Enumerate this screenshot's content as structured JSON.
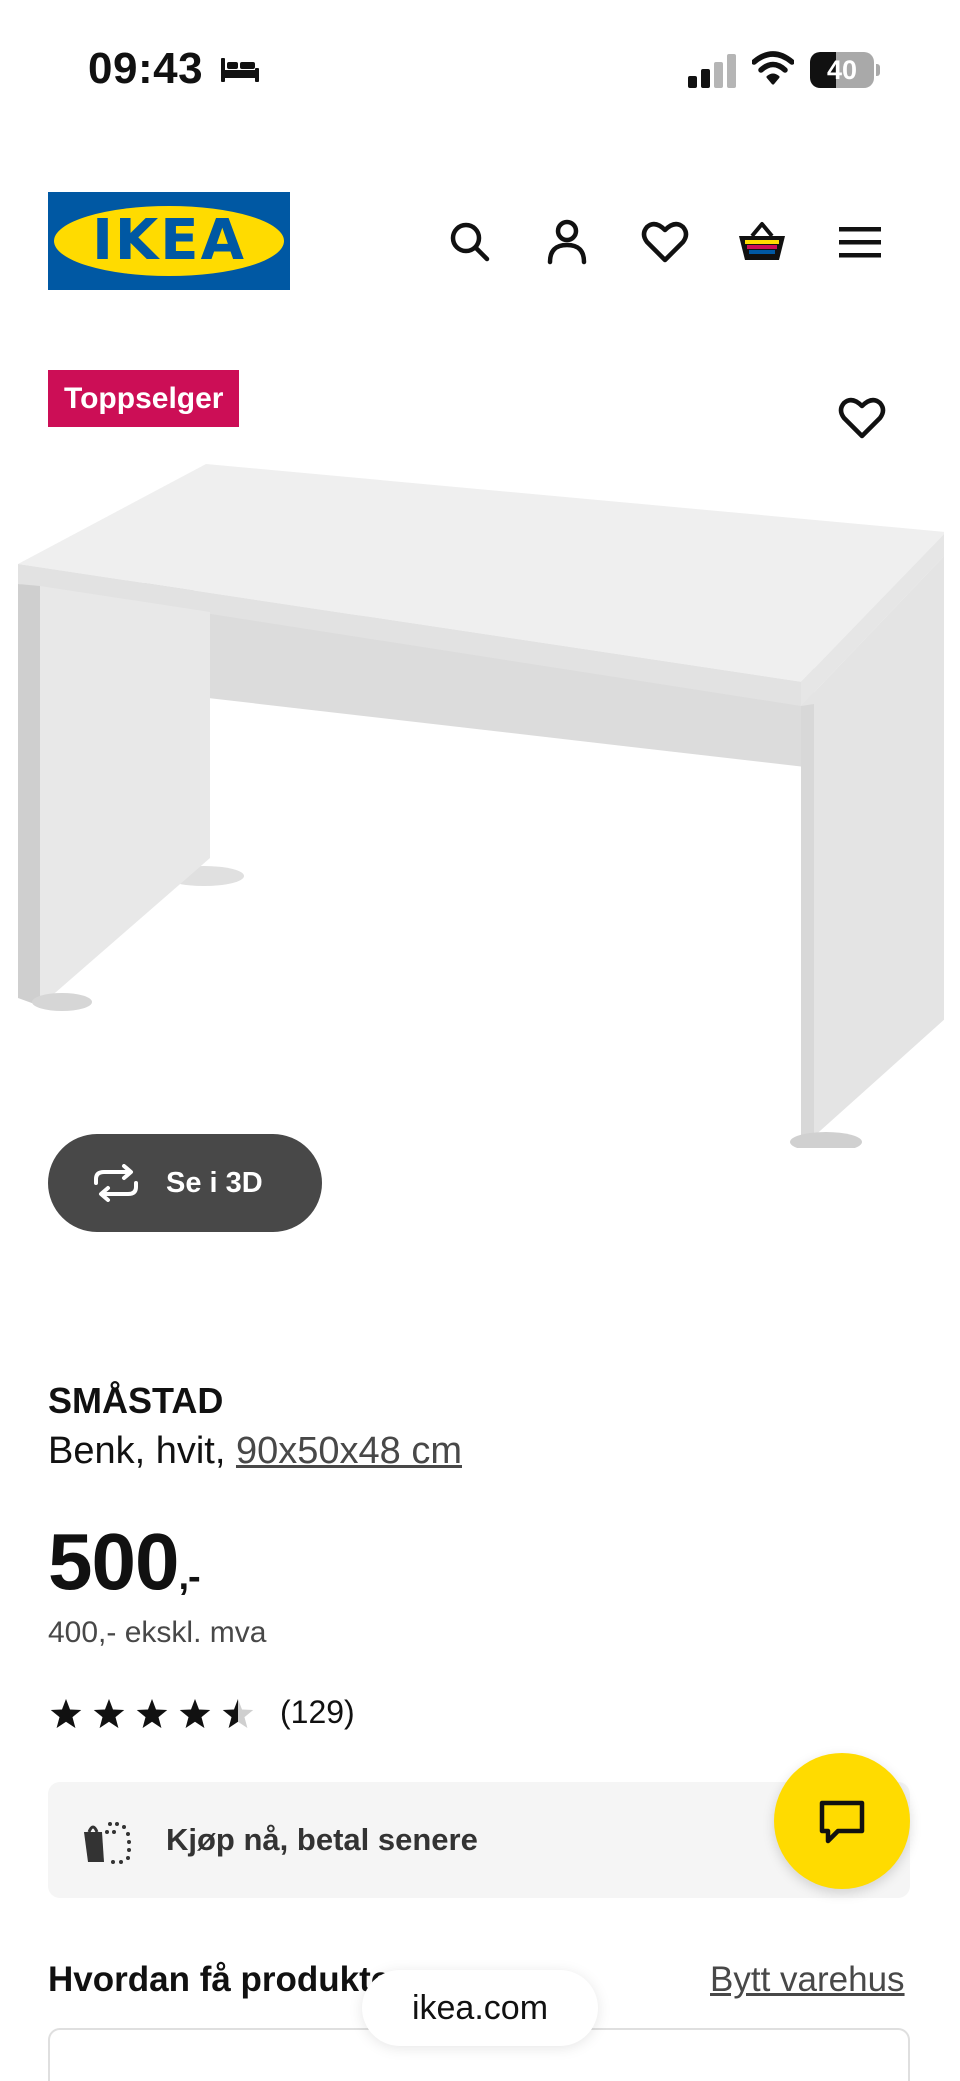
{
  "status_bar": {
    "time": "09:43",
    "battery_level": "40",
    "battery_fraction": 0.4,
    "icons": [
      "bed-icon",
      "cellular-signal-icon",
      "wifi-icon",
      "battery-icon"
    ]
  },
  "header": {
    "logo_text": "IKEA",
    "icons": [
      "search-icon",
      "account-icon",
      "heart-icon",
      "basket-icon",
      "menu-icon"
    ],
    "brand_colors": {
      "blue": "#0058a3",
      "yellow": "#ffdb00"
    }
  },
  "product": {
    "badge": "Toppselger",
    "badge_color": "#cc0e56",
    "view_3d_label": "Se i 3D",
    "name": "SMÅSTAD",
    "description_prefix": "Benk, hvit,",
    "size": "90x50x48 cm",
    "price_main": "500",
    "price_suffix": ",-",
    "price_ex_vat": "400,- ekskl. mva",
    "rating_value": 4.5,
    "rating_max": 5,
    "rating_count": "(129)"
  },
  "pay_later": {
    "label": "Kjøp nå, betal senere"
  },
  "delivery": {
    "title": "Hvordan få produkter",
    "change_store": "Bytt varehus"
  },
  "browser": {
    "url": "ikea.com"
  },
  "chat": {
    "icon": "chat-icon",
    "color": "#ffdb00"
  }
}
